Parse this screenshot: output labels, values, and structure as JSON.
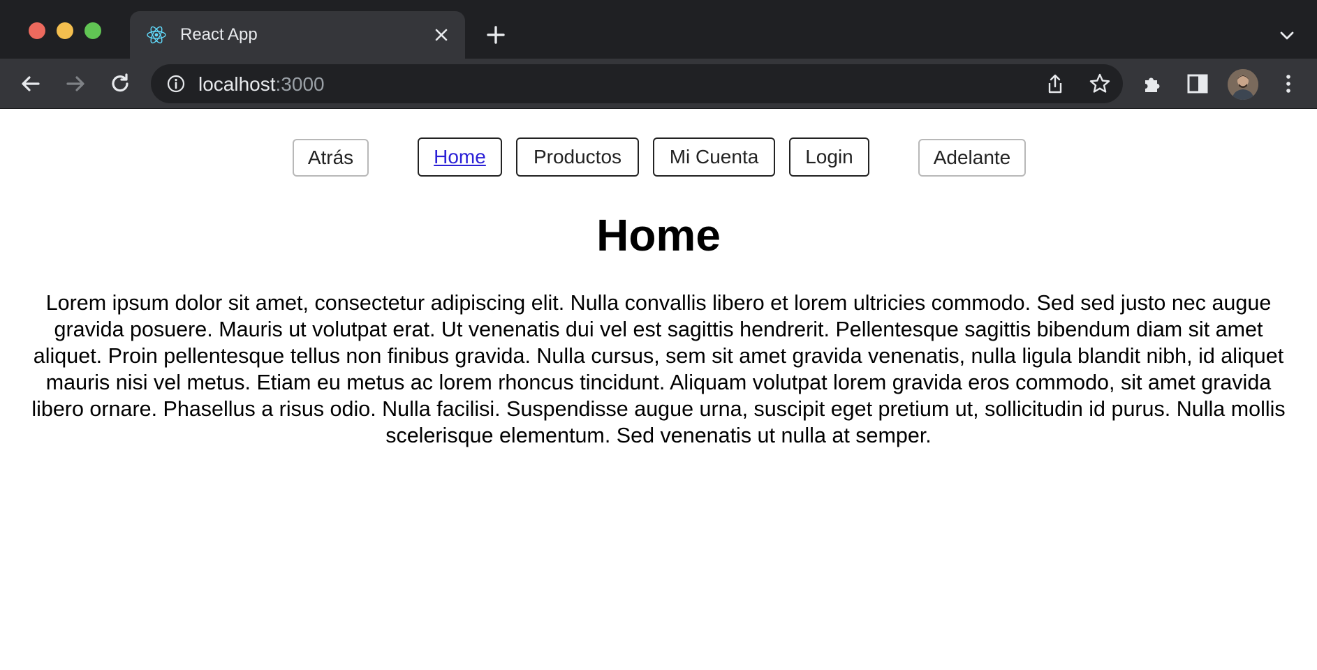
{
  "browser": {
    "tab_title": "React App",
    "url_host": "localhost",
    "url_port": ":3000",
    "icons": {
      "favicon": "react-icon",
      "close": "close-icon",
      "new_tab": "plus-icon",
      "tab_list": "chevron-down-icon",
      "back": "arrow-left-icon",
      "forward": "arrow-right-icon",
      "reload": "reload-icon",
      "site_info": "info-icon",
      "share": "share-icon",
      "bookmark": "star-icon",
      "extensions": "puzzle-icon",
      "side_panel": "side-panel-icon",
      "profile": "avatar",
      "menu": "kebab-menu-icon"
    }
  },
  "nav": {
    "back_label": "Atrás",
    "home_label": "Home",
    "products_label": "Productos",
    "account_label": "Mi Cuenta",
    "login_label": "Login",
    "forward_label": "Adelante"
  },
  "main": {
    "title": "Home",
    "paragraph": "Lorem ipsum dolor sit amet, consectetur adipiscing elit. Nulla convallis libero et lorem ultricies commodo. Sed sed justo nec augue gravida posuere. Mauris ut volutpat erat. Ut venenatis dui vel est sagittis hendrerit. Pellentesque sagittis bibendum diam sit amet aliquet. Proin pellentesque tellus non finibus gravida. Nulla cursus, sem sit amet gravida venenatis, nulla ligula blandit nibh, id aliquet mauris nisi vel metus. Etiam eu metus ac lorem rhoncus tincidunt. Aliquam volutpat lorem gravida eros commodo, sit amet gravida libero ornare. Phasellus a risus odio. Nulla facilisi. Suspendisse augue urna, suscipit eget pretium ut, sollicitudin id purus. Nulla mollis scelerisque elementum. Sed venenatis ut nulla at semper."
  },
  "colors": {
    "chrome_dark": "#1f2023",
    "chrome_mid": "#35363a",
    "omnibox": "#202124",
    "link": "#2a1fd6"
  }
}
